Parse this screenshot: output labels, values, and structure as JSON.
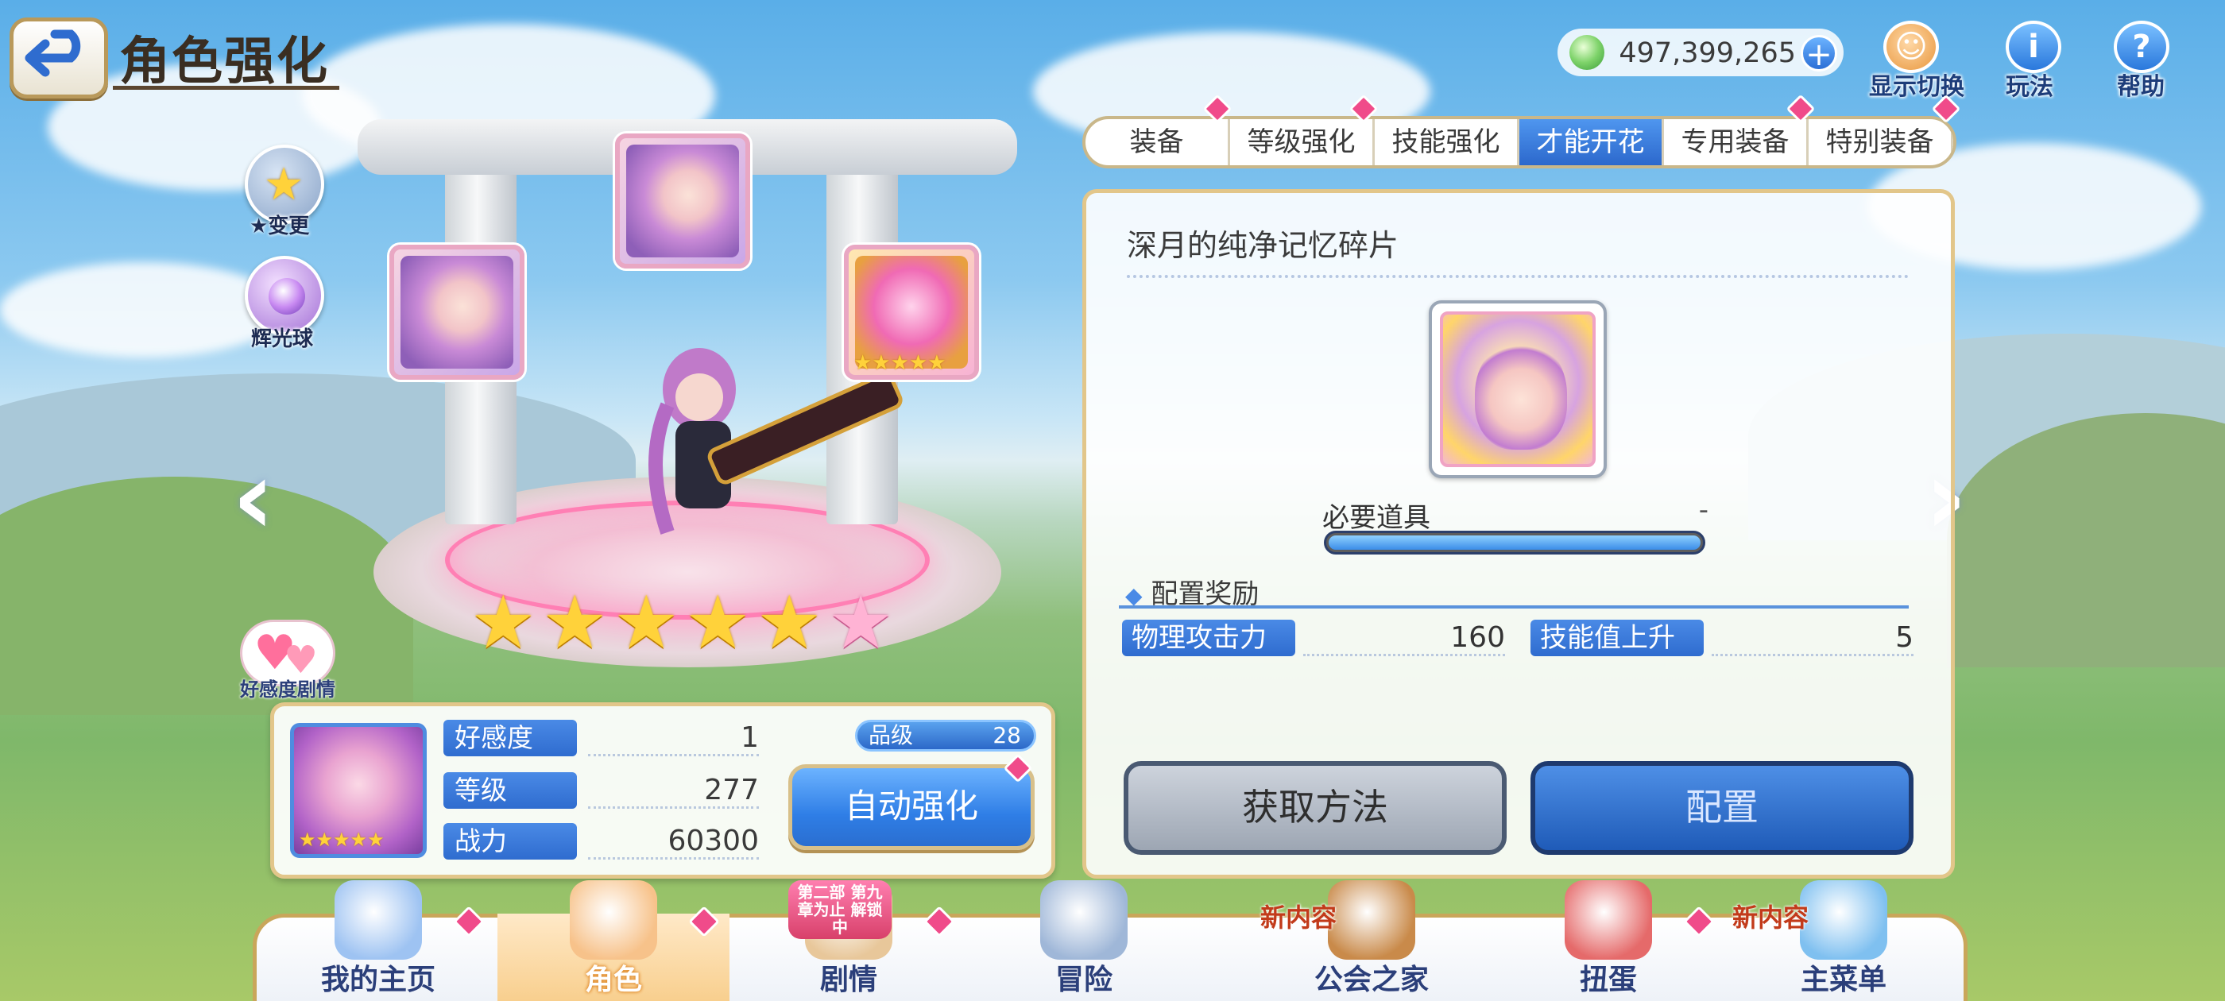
{
  "header": {
    "title": "角色强化",
    "back_label": "返回"
  },
  "currency": {
    "amount": "497,399,265",
    "plus": "+"
  },
  "top_right": [
    {
      "label": "显示切换",
      "icon": "character-icon"
    },
    {
      "label": "玩法",
      "icon": "info-icon",
      "glyph": "i"
    },
    {
      "label": "帮助",
      "icon": "help-icon",
      "glyph": "?"
    }
  ],
  "side_buttons": [
    {
      "label": "★变更",
      "icon": "star-change-icon"
    },
    {
      "label": "辉光球",
      "icon": "glow-orb-icon"
    }
  ],
  "affection_button": {
    "label": "好感度剧情"
  },
  "star_rating": {
    "filled": 5,
    "total": 6
  },
  "character": {
    "stats": [
      {
        "label": "好感度",
        "value": "1"
      },
      {
        "label": "等级",
        "value": "277"
      },
      {
        "label": "战力",
        "value": "60300"
      }
    ],
    "rank_label": "品级",
    "rank_value": "28",
    "auto_button": "自动强化"
  },
  "tabs": [
    {
      "label": "装备",
      "active": false,
      "notify": true
    },
    {
      "label": "等级强化",
      "active": false,
      "notify": true
    },
    {
      "label": "技能强化",
      "active": false,
      "notify": false
    },
    {
      "label": "才能开花",
      "active": true,
      "notify": false
    },
    {
      "label": "专用装备",
      "active": false,
      "notify": true
    },
    {
      "label": "特别装备",
      "active": false,
      "notify": true
    }
  ],
  "panel": {
    "item_name": "深月的纯净记忆碎片",
    "required_label": "必要道具",
    "required_value": "-",
    "reward_title": "配置奖励",
    "rewards": [
      {
        "label": "物理攻击力",
        "value": "160"
      },
      {
        "label": "技能值上升",
        "value": "5"
      }
    ],
    "obtain_button": "获取方法",
    "equip_button": "配置"
  },
  "nav": [
    {
      "label": "我的主页",
      "badge": "",
      "notify": true,
      "active": false
    },
    {
      "label": "角色",
      "badge": "",
      "notify": true,
      "active": true
    },
    {
      "label": "剧情",
      "badge": "第二部 第九章为止 解锁中",
      "notify": true,
      "active": false
    },
    {
      "label": "冒险",
      "badge": "",
      "notify": false,
      "active": false
    },
    {
      "label": "公会之家",
      "badge": "新内容",
      "notify": false,
      "active": false
    },
    {
      "label": "扭蛋",
      "badge": "",
      "notify": true,
      "active": false
    },
    {
      "label": "主菜单",
      "badge": "新内容",
      "notify": false,
      "active": false
    }
  ],
  "colors": {
    "accent_blue": "#2f6ccf",
    "notify_pink": "#f04b8a",
    "frame_gold": "#e2c68a"
  }
}
